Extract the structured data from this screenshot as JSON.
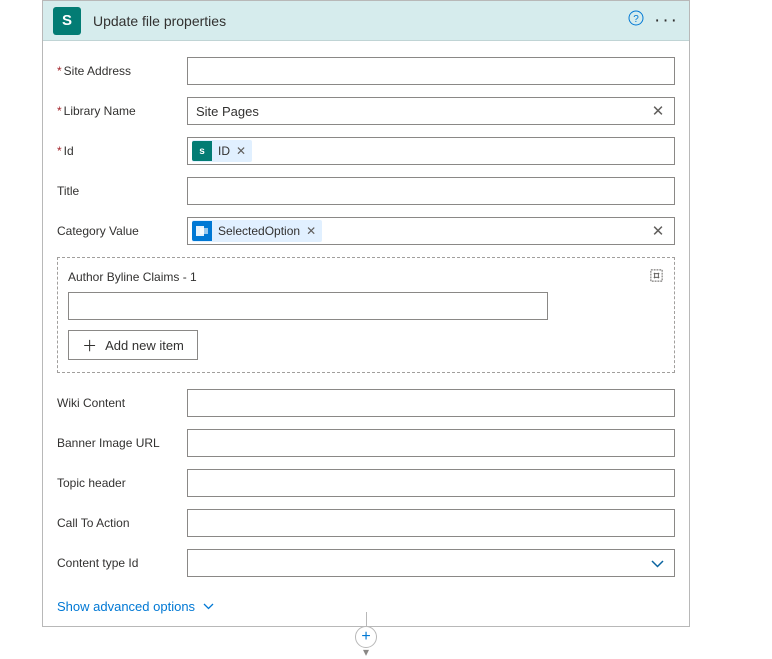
{
  "header": {
    "icon_letter": "S",
    "title": "Update file properties"
  },
  "fields": {
    "site_address": {
      "label": "Site Address",
      "required": true
    },
    "library_name": {
      "label": "Library Name",
      "required": true,
      "value": "Site Pages"
    },
    "id": {
      "label": "Id",
      "required": true,
      "token_label": "ID"
    },
    "title": {
      "label": "Title",
      "required": false
    },
    "category_value": {
      "label": "Category Value",
      "required": false,
      "token_label": "SelectedOption"
    },
    "author": {
      "label": "Author Byline Claims - 1",
      "add_label": "Add new item"
    },
    "wiki_content": {
      "label": "Wiki Content"
    },
    "banner_url": {
      "label": "Banner Image URL"
    },
    "topic_header": {
      "label": "Topic header"
    },
    "call_to_action": {
      "label": "Call To Action"
    },
    "content_type_id": {
      "label": "Content type Id"
    }
  },
  "advanced_label": "Show advanced options"
}
